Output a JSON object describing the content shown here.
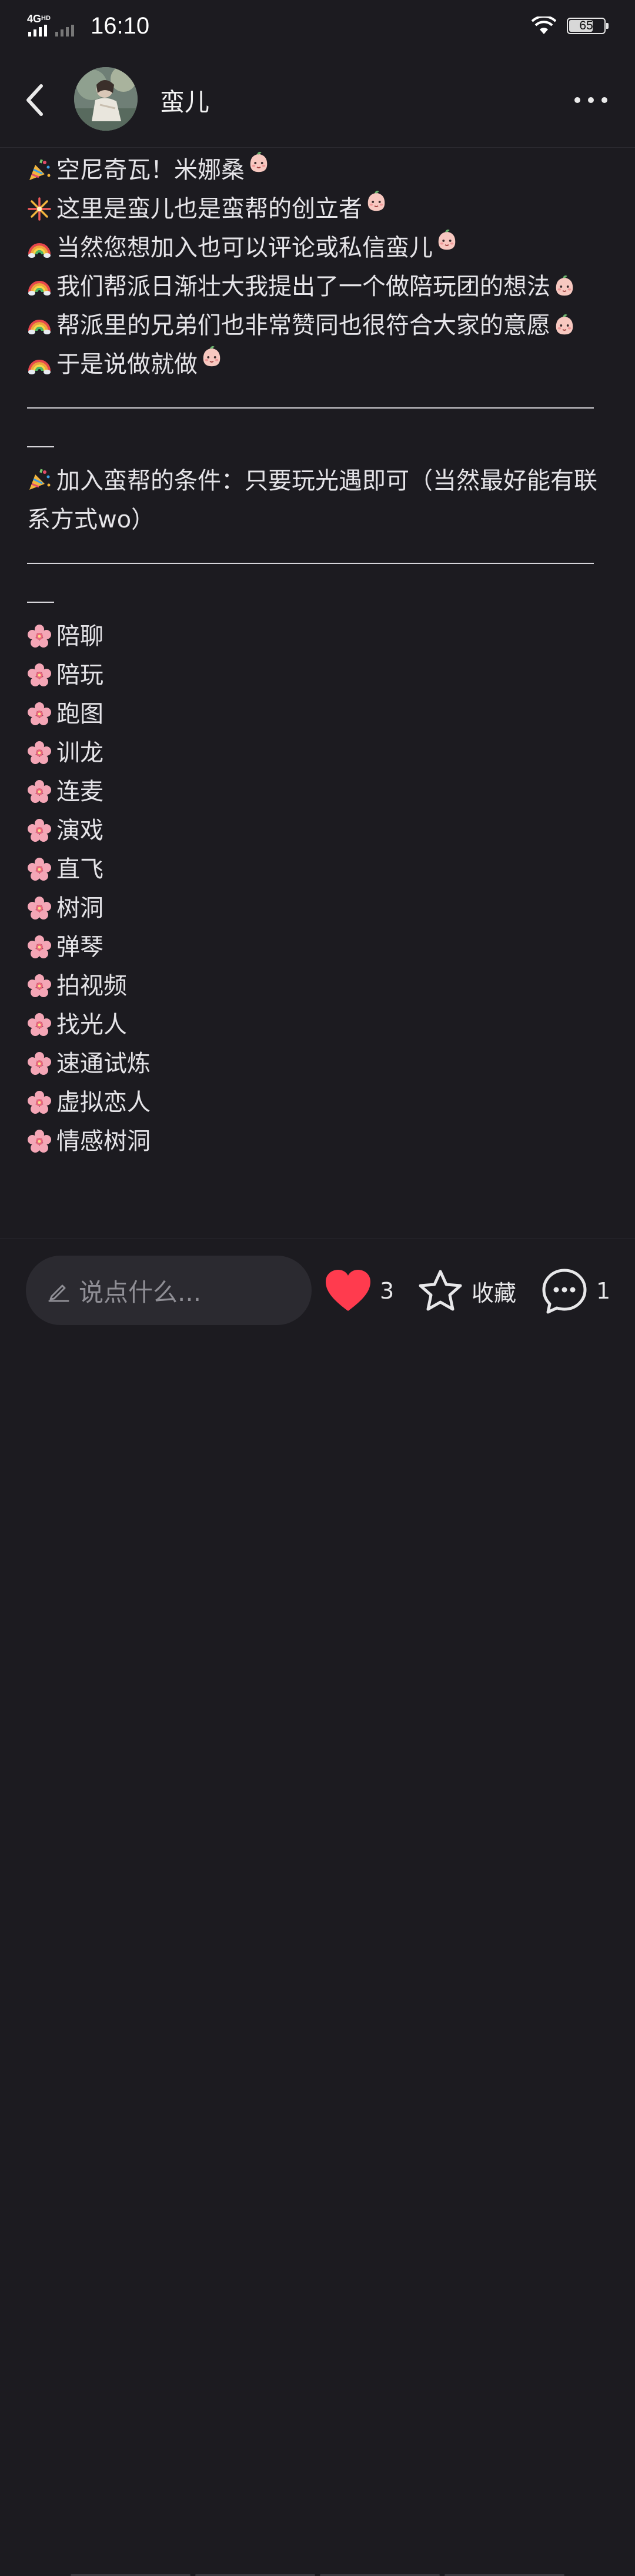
{
  "status_bar": {
    "network": "4G HD",
    "time": "16:10",
    "battery": "65",
    "battery_level": 0.65
  },
  "nav": {
    "title": "蛮儿",
    "back_icon": "chevron-left-icon",
    "more_icon": "more-horizontal-icon"
  },
  "post": {
    "lines": [
      {
        "icon": "party-popper-icon",
        "text": "空尼奇瓦！米娜桑",
        "tail": "peach-face-icon"
      },
      {
        "icon": "fireworks-icon",
        "text": "这里是蛮儿也是蛮帮的创立者",
        "tail": "peach-face-icon"
      },
      {
        "icon": "rainbow-icon",
        "text": "当然您想加入也可以评论或私信蛮儿",
        "tail": "peach-face-icon"
      },
      {
        "icon": "rainbow-icon",
        "text": "我们帮派日渐壮大我提出了一个做陪玩团的想法",
        "tail": "peach-face-icon"
      },
      {
        "icon": "rainbow-icon",
        "text": "帮派里的兄弟们也非常赞同也很符合大家的意愿",
        "tail": "peach-face-icon"
      },
      {
        "icon": "rainbow-icon",
        "text": "于是说做就做",
        "tail": "peach-face-icon"
      }
    ],
    "condition": {
      "icon": "party-popper-icon",
      "text": "加入蛮帮的条件：只要玩光遇即可（当然最好能有联系方式wo）"
    },
    "services": [
      "陪聊",
      "陪玩",
      "跑图",
      "训龙",
      "连麦",
      "演戏",
      "直飞",
      "树洞",
      "弹琴",
      "拍视频",
      "找光人",
      "速通试炼",
      "虚拟恋人",
      "情感树洞"
    ],
    "service_icon": "cherry-blossom-icon"
  },
  "bottom_bar": {
    "comment_placeholder": "说点什么...",
    "like_count": "3",
    "favorite_label": "收藏",
    "comment_count": "1",
    "colors": {
      "like": "#ff3b4e",
      "accent": "#e8e8ea"
    }
  }
}
